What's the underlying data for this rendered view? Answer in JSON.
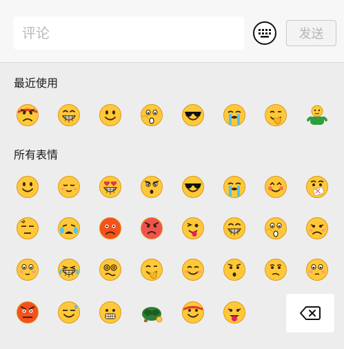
{
  "composer": {
    "placeholder": "评论",
    "send_label": "发送"
  },
  "sections": {
    "recent_title": "最近使用",
    "all_title": "所有表情"
  },
  "recent_emojis": [
    "angry-headband-emoji",
    "grin-emoji",
    "smile-emoji",
    "scared-emoji",
    "cool-sunglasses-emoji",
    "crying-emoji",
    "facepalm-emoji",
    "green-figure-emoji"
  ],
  "all_emojis": [
    [
      "smile-emoji",
      "blush-emoji",
      "heart-eyes-emoji",
      "shocked-emoji",
      "cool-sunglasses-emoji",
      "crying-emoji",
      "star-eyes-emoji",
      "sick-emoji"
    ],
    [
      "annoyed-emoji",
      "sob-emoji",
      "red-angry-emoji",
      "furious-emoji",
      "wink-tongue-emoji",
      "grin-emoji",
      "scared-emoji",
      "sad-emoji"
    ],
    [
      "shy-emoji",
      "laugh-cry-emoji",
      "dizzy-emoji",
      "facepalm-emoji",
      "happy-emoji",
      "surprised-emoji",
      "worried-emoji",
      "pitiful-emoji"
    ],
    [
      "angry-emoji",
      "sweat-smile-emoji",
      "teeth-emoji",
      "turtle-emoji",
      "headband-emoji",
      "tongue-emoji"
    ]
  ],
  "colors": {
    "background": "#ededed",
    "emoji_yellow": "#ffc83a"
  }
}
